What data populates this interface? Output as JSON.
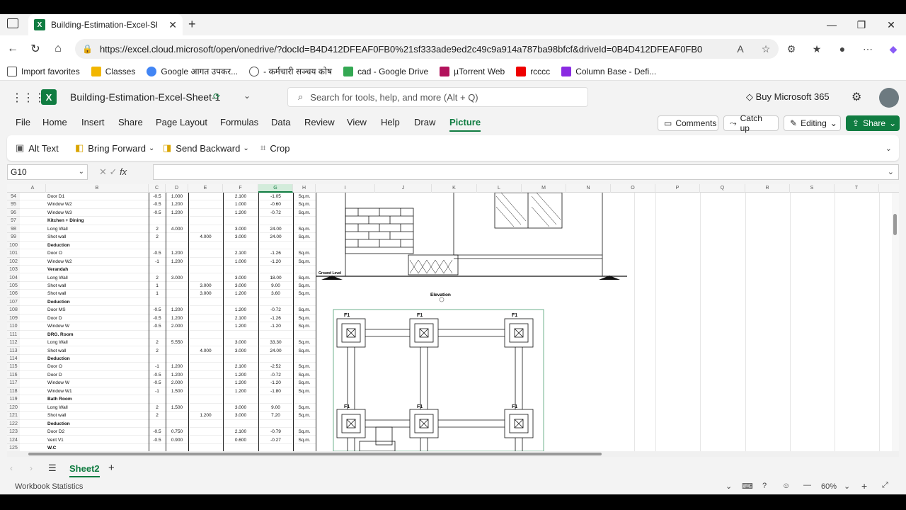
{
  "browser": {
    "tab_title": "Building-Estimation-Excel-Sheet-1",
    "url": "https://excel.cloud.microsoft/open/onedrive/?docId=B4D412DFEAF0FB0%21sf333ade9ed2c49c9a914a787ba98bfcf&driveId=0B4D412DFEAF0FB0",
    "favorites": [
      "Import favorites",
      "Classes",
      "Google आगत उपकर...",
      "- कर्मचारी सञ्चय कोष",
      "cad - Google Drive",
      "µTorrent Web",
      "rcccc",
      "Column Base - Defi..."
    ]
  },
  "app": {
    "doc_title": "Building-Estimation-Excel-Sheet-1",
    "search_placeholder": "Search for tools, help, and more (Alt + Q)",
    "buy_label": "Buy Microsoft 365",
    "menu": [
      "File",
      "Home",
      "Insert",
      "Share",
      "Page Layout",
      "Formulas",
      "Data",
      "Review",
      "View",
      "Help",
      "Draw",
      "Picture"
    ],
    "comments": "Comments",
    "catchup": "Catch up",
    "editing": "Editing",
    "share": "Share"
  },
  "ribbon": {
    "alt_text": "Alt Text",
    "bring_forward": "Bring Forward",
    "send_backward": "Send Backward",
    "crop": "Crop"
  },
  "formula": {
    "name_box": "G10",
    "fx": "fx"
  },
  "columns": [
    "A",
    "B",
    "C",
    "D",
    "E",
    "F",
    "G",
    "H",
    "I",
    "J",
    "K",
    "L",
    "M",
    "N",
    "O",
    "P",
    "Q",
    "R",
    "S",
    "T"
  ],
  "rows": [
    {
      "n": "94",
      "b": "Door D1",
      "c": "-0.5",
      "d": "1.000",
      "e": "",
      "f": "2.100",
      "g": "-1.05",
      "h": "Sq.m."
    },
    {
      "n": "95",
      "b": "Window W2",
      "c": "-0.5",
      "d": "1.200",
      "e": "",
      "f": "1.000",
      "g": "-0.60",
      "h": "Sq.m."
    },
    {
      "n": "96",
      "b": "Window W3",
      "c": "-0.5",
      "d": "1.200",
      "e": "",
      "f": "1.200",
      "g": "-0.72",
      "h": "Sq.m."
    },
    {
      "n": "97",
      "b": "Kitchen + Dining",
      "bold": true,
      "c": "",
      "d": "",
      "e": "",
      "f": "",
      "g": "",
      "h": ""
    },
    {
      "n": "98",
      "b": "Long Wall",
      "c": "2",
      "d": "4.000",
      "e": "",
      "f": "3.000",
      "g": "24.00",
      "h": "Sq.m."
    },
    {
      "n": "99",
      "b": "Shot wall",
      "c": "2",
      "d": "",
      "e": "4.000",
      "f": "3.000",
      "g": "24.00",
      "h": "Sq.m."
    },
    {
      "n": "100",
      "b": "Deduction",
      "bold": true,
      "c": "",
      "d": "",
      "e": "",
      "f": "",
      "g": "",
      "h": ""
    },
    {
      "n": "101",
      "b": "Door O",
      "c": "-0.5",
      "d": "1.200",
      "e": "",
      "f": "2.100",
      "g": "-1.26",
      "h": "Sq.m."
    },
    {
      "n": "102",
      "b": "Window W2",
      "c": "-1",
      "d": "1.200",
      "e": "",
      "f": "1.000",
      "g": "-1.20",
      "h": "Sq.m."
    },
    {
      "n": "103",
      "b": "Verandah",
      "bold": true,
      "c": "",
      "d": "",
      "e": "",
      "f": "",
      "g": "",
      "h": ""
    },
    {
      "n": "104",
      "b": "Long Wall",
      "c": "2",
      "d": "3.000",
      "e": "",
      "f": "3.000",
      "g": "18.00",
      "h": "Sq.m."
    },
    {
      "n": "105",
      "b": "Shot wall",
      "c": "1",
      "d": "",
      "e": "3.000",
      "f": "3.000",
      "g": "9.00",
      "h": "Sq.m."
    },
    {
      "n": "106",
      "b": "Shot wall",
      "c": "1",
      "d": "",
      "e": "3.000",
      "f": "1.200",
      "g": "3.60",
      "h": "Sq.m."
    },
    {
      "n": "107",
      "b": "Deduction",
      "bold": true,
      "c": "",
      "d": "",
      "e": "",
      "f": "",
      "g": "",
      "h": ""
    },
    {
      "n": "108",
      "b": "Door MS",
      "c": "-0.5",
      "d": "1.200",
      "e": "",
      "f": "1.200",
      "g": "-0.72",
      "h": "Sq.m."
    },
    {
      "n": "109",
      "b": "Door D",
      "c": "-0.5",
      "d": "1.200",
      "e": "",
      "f": "2.100",
      "g": "-1.26",
      "h": "Sq.m."
    },
    {
      "n": "110",
      "b": "Window W",
      "c": "-0.5",
      "d": "2.000",
      "e": "",
      "f": "1.200",
      "g": "-1.20",
      "h": "Sq.m."
    },
    {
      "n": "111",
      "b": "DRG. Room",
      "bold": true,
      "c": "",
      "d": "",
      "e": "",
      "f": "",
      "g": "",
      "h": ""
    },
    {
      "n": "112",
      "b": "Long Wall",
      "c": "2",
      "d": "5.550",
      "e": "",
      "f": "3.000",
      "g": "33.30",
      "h": "Sq.m."
    },
    {
      "n": "113",
      "b": "Shot wall",
      "c": "2",
      "d": "",
      "e": "4.000",
      "f": "3.000",
      "g": "24.00",
      "h": "Sq.m."
    },
    {
      "n": "114",
      "b": "Deduction",
      "bold": true,
      "c": "",
      "d": "",
      "e": "",
      "f": "",
      "g": "",
      "h": ""
    },
    {
      "n": "115",
      "b": "Door O",
      "c": "-1",
      "d": "1.200",
      "e": "",
      "f": "2.100",
      "g": "-2.52",
      "h": "Sq.m."
    },
    {
      "n": "116",
      "b": "Door D",
      "c": "-0.5",
      "d": "1.200",
      "e": "",
      "f": "1.200",
      "g": "-0.72",
      "h": "Sq.m."
    },
    {
      "n": "117",
      "b": "Window W",
      "c": "-0.5",
      "d": "2.000",
      "e": "",
      "f": "1.200",
      "g": "-1.20",
      "h": "Sq.m."
    },
    {
      "n": "118",
      "b": "Window W1",
      "c": "-1",
      "d": "1.500",
      "e": "",
      "f": "1.200",
      "g": "-1.80",
      "h": "Sq.m."
    },
    {
      "n": "119",
      "b": "Bath Room",
      "bold": true,
      "c": "",
      "d": "",
      "e": "",
      "f": "",
      "g": "",
      "h": ""
    },
    {
      "n": "120",
      "b": "Long Wall",
      "c": "2",
      "d": "1.500",
      "e": "",
      "f": "3.000",
      "g": "9.00",
      "h": "Sq.m."
    },
    {
      "n": "121",
      "b": "Shot wall",
      "c": "2",
      "d": "",
      "e": "1.200",
      "f": "3.000",
      "g": "7.20",
      "h": "Sq.m."
    },
    {
      "n": "122",
      "b": "Deduction",
      "bold": true,
      "c": "",
      "d": "",
      "e": "",
      "f": "",
      "g": "",
      "h": ""
    },
    {
      "n": "123",
      "b": "Door D2",
      "c": "-0.5",
      "d": "0.750",
      "e": "",
      "f": "2.100",
      "g": "-0.79",
      "h": "Sq.m."
    },
    {
      "n": "124",
      "b": "Vent V1",
      "c": "-0.5",
      "d": "0.900",
      "e": "",
      "f": "0.600",
      "g": "-0.27",
      "h": "Sq.m."
    },
    {
      "n": "125",
      "b": "W.C",
      "bold": true,
      "c": "",
      "d": "",
      "e": "",
      "f": "",
      "g": "",
      "h": ""
    }
  ],
  "drawing": {
    "ground_level": "Ground Level",
    "elevation": "Elevation",
    "footing_label": "F1"
  },
  "sheet": {
    "tab": "Sheet2",
    "add": "+"
  },
  "status": {
    "workbook_stats": "Workbook Statistics",
    "zoom": "60%"
  }
}
